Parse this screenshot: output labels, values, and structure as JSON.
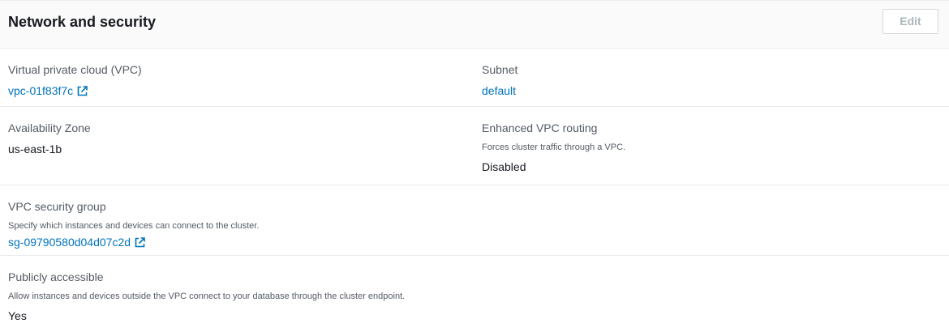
{
  "header": {
    "title": "Network and security",
    "edit_label": "Edit"
  },
  "fields": {
    "vpc": {
      "label": "Virtual private cloud (VPC)",
      "value": "vpc-01f83f7c",
      "icon": "external-link-icon"
    },
    "subnet": {
      "label": "Subnet",
      "value": "default"
    },
    "availability_zone": {
      "label": "Availability Zone",
      "value": "us-east-1b"
    },
    "enhanced_vpc_routing": {
      "label": "Enhanced VPC routing",
      "description": "Forces cluster traffic through a VPC.",
      "value": "Disabled"
    },
    "vpc_security_group": {
      "label": "VPC security group",
      "description": "Specify which instances and devices can connect to the cluster.",
      "value": "sg-09790580d04d07c2d",
      "icon": "external-link-icon"
    },
    "publicly_accessible": {
      "label": "Publicly accessible",
      "description": "Allow instances and devices outside the VPC connect to your database through the cluster endpoint.",
      "value": "Yes"
    }
  },
  "colors": {
    "link": "#0073bb",
    "label": "#545b64",
    "text": "#16191f",
    "header_bg": "#fafafa",
    "divider": "#eaeded",
    "disabled_button_text": "#aab7b8"
  }
}
